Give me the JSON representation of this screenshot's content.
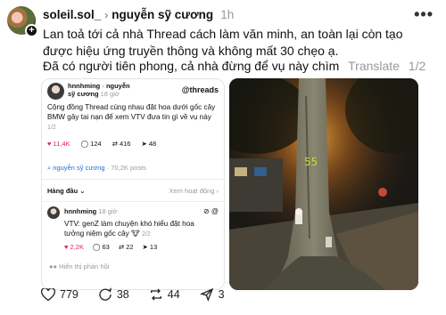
{
  "post": {
    "username": "soleil.sol_",
    "chevron": "›",
    "reply_to": "nguyễn sỹ cương",
    "time": "1h",
    "more": "•••",
    "text": "Lan toả tới cả nhà Thread cách làm văn minh, an toàn lại còn tạo được hiệu ứng truyền thông và không mất 30 chẹo ạ.",
    "text_line2": "Đã có người tiên phong, cả nhà đừng để vụ này chìm",
    "translate": "Translate",
    "page_indicator": "1/2"
  },
  "embedded": {
    "username": "hnnhming",
    "chevron": "›",
    "reply_to": "nguyễn",
    "reply_to_2": "sỹ cương",
    "time": "18 giờ",
    "logo": "threads",
    "text": "Cộng đồng Thread cùng nhau đặt hoa dưới gốc cây BMW gây tai nạn để xem VTV đưa tin gì về vụ này",
    "page": "1/2",
    "likes": "11,4K",
    "comments": "124",
    "reposts": "416",
    "shares": "48",
    "profile_link": "nguyễn sỹ cương",
    "profile_posts": "70,2K posts",
    "sort": "Hàng đầu",
    "sort_chevron": "⌄",
    "activity_link": "Xem hoạt động",
    "reply": {
      "username": "hnnhming",
      "time": "18 giờ",
      "text": "VTV: genZ làm chuyện khó hiểu đặt hoa tưởng niệm gốc cây",
      "emoji": "🐮",
      "page": "2/2",
      "likes": "2,2K",
      "comments": "63",
      "reposts": "22",
      "shares": "13"
    },
    "hidden_replies": "Hiển thị phản hồi"
  },
  "photo": {
    "tree_number": "55"
  },
  "actions": {
    "likes": "779",
    "comments": "38",
    "reposts": "44",
    "shares": "3"
  },
  "colors": {
    "like_red": "#e0245e",
    "link_blue": "#1a6fd6",
    "muted_gray": "#999999"
  }
}
